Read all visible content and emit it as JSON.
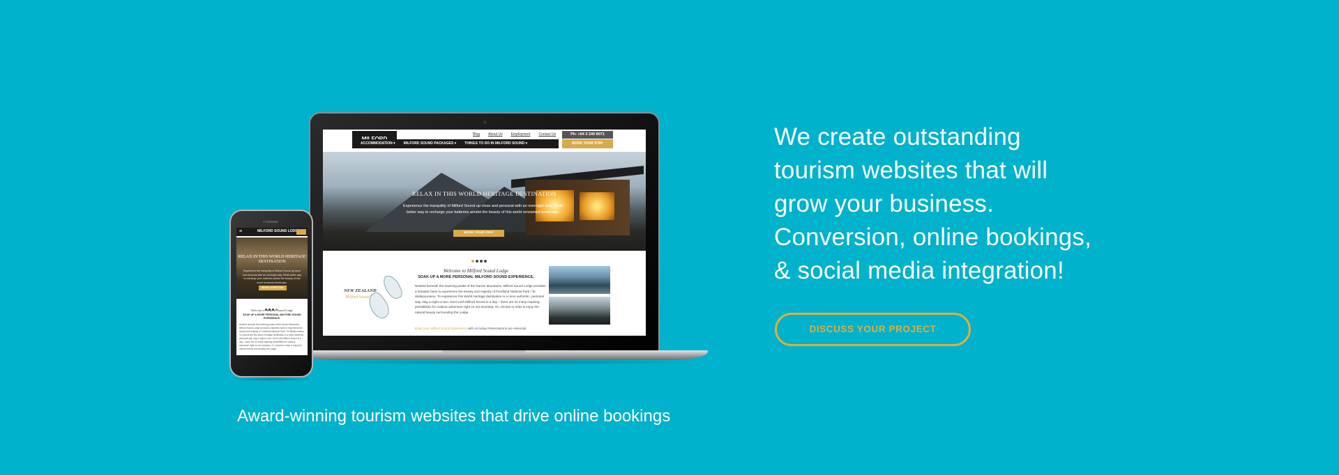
{
  "colors": {
    "background": "#00b2cb",
    "accent": "#e2ae3d",
    "text": "#ffffff"
  },
  "headline_lines": [
    "We create outstanding",
    "tourism websites that will",
    "grow your business.",
    "Conversion, online bookings,",
    "& social media integration!"
  ],
  "cta_label": "DISCUSS YOUR PROJECT",
  "caption": "Award-winning tourism websites that drive online bookings",
  "laptop_site": {
    "logo": "MILFORD SOUND LODGE",
    "top_links": [
      "Blog",
      "About Us",
      "Employment",
      "Contact Us"
    ],
    "phone": "Ph: +64 3 249 8071",
    "nav": [
      "ACCOMMODATION ▾",
      "MILFORD SOUND PACKAGES ▾",
      "THINGS TO DO IN MILFORD SOUND ▾"
    ],
    "book_label": "BOOK YOUR STAY",
    "hero_title": "RELAX IN THIS WORLD HERITAGE DESTINATION",
    "hero_text": "Experience the tranquility of Milford Sound up close and personal with an overnight stay. What better way to recharge your batteries amidst the beauty of this world renowned landscape.",
    "hero_button": "BOOK YOUR STAY",
    "map_label_1": "NEW ZEALAND",
    "map_label_2": "Milford Sound",
    "welcome_title": "Welcome to Milford Sound Lodge",
    "welcome_subtitle": "SOAK UP A MORE PERSONAL MILFORD SOUND EXPERIENCE.",
    "welcome_body": "Nestled beneath the towering peaks of the Darran Mountains, Milford Sound Lodge provides a fantastic base to experience the beauty and majesty of Fiordland National Park / Te Wahipounamu. To experience this World Heritage destination in a more authentic, personal way, stay a night or two. Don't rush Milford Sound in a day – there are so many inspiring possibilities for outdoor adventure right on our doorstep. Or, choose to relax & enjoy the natural beauty surrounding the Lodge.",
    "welcome_link": "Book your Milford Sound Experience",
    "welcome_link_rest": " with us today! Reservations are essential."
  },
  "phone_site": {
    "menu_icon": "≡",
    "logo": "MILFORD SOUND LODGE",
    "hero_title": "RELAX IN THIS WORLD HERITAGE DESTINATION",
    "hero_text": "Experience the tranquility of Milford Sound up close and personal with an overnight stay. What better way to recharge your batteries amidst the beauty of this world renowned landscape.",
    "hero_button": "BOOK YOUR STAY",
    "welcome_title": "Welcome to Milford Sound Lodge",
    "welcome_subtitle": "SOAK UP A MORE PERSONAL MILFORD SOUND EXPERIENCE.",
    "welcome_body": "Nestled beneath the towering peaks of the Darran Mountains, Milford Sound Lodge provides a fantastic base to experience the beauty and majesty of Fiordland National Park / Te Wahipounamu. To experience this World Heritage destination in a more authentic, personal way, stay a night or two. Don't rush Milford Sound in a day – there are so many inspiring possibilities for outdoor adventure right on our doorstep. Or, choose to relax & enjoy the natural beauty surrounding the Lodge."
  }
}
